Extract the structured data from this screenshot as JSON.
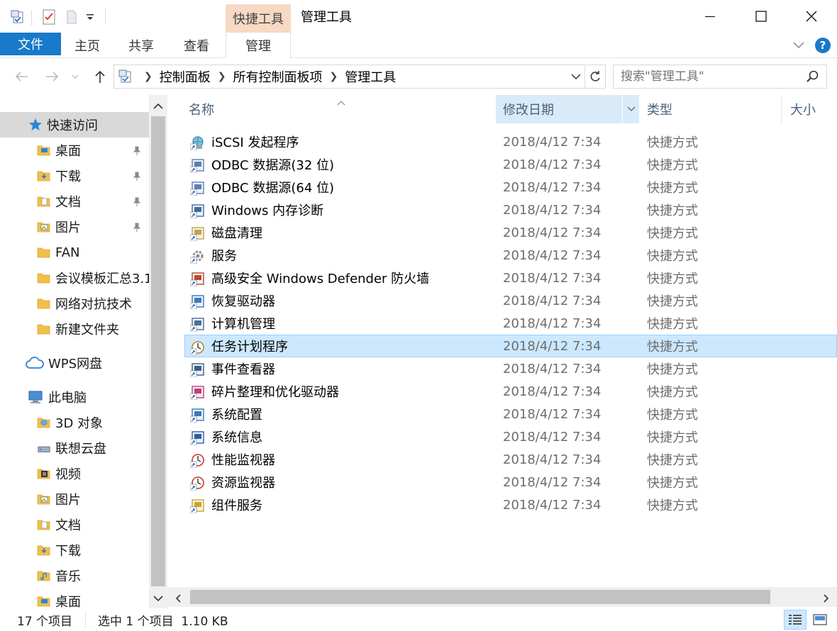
{
  "window": {
    "title": "管理工具",
    "context_tab": "快捷工具",
    "controls": {
      "minimize": "minimize-icon",
      "maximize": "maximize-icon",
      "close": "close-icon"
    }
  },
  "ribbon": {
    "file": "文件",
    "tabs": [
      "主页",
      "共享",
      "查看",
      "管理"
    ],
    "help_label": "?"
  },
  "address": {
    "crumbs": [
      "控制面板",
      "所有控制面板项",
      "管理工具"
    ],
    "search_placeholder": "搜索\"管理工具\""
  },
  "nav": {
    "quick_access": "快速访问",
    "items": [
      {
        "label": "桌面",
        "icon": "folder-blue-icon",
        "pinned": true
      },
      {
        "label": "下载",
        "icon": "download-folder-icon",
        "pinned": true
      },
      {
        "label": "文档",
        "icon": "documents-folder-icon",
        "pinned": true
      },
      {
        "label": "图片",
        "icon": "pictures-folder-icon",
        "pinned": true
      },
      {
        "label": "FAN",
        "icon": "folder-icon",
        "pinned": false
      },
      {
        "label": "会议模板汇总3.1",
        "icon": "folder-icon",
        "pinned": false
      },
      {
        "label": "网络对抗技术",
        "icon": "folder-icon",
        "pinned": false
      },
      {
        "label": "新建文件夹",
        "icon": "folder-icon",
        "pinned": false
      }
    ],
    "wps": "WPS网盘",
    "this_pc": "此电脑",
    "pc_items": [
      {
        "label": "3D 对象",
        "icon": "3d-objects-folder-icon"
      },
      {
        "label": "联想云盘",
        "icon": "cloud-drive-icon"
      },
      {
        "label": "视频",
        "icon": "videos-folder-icon"
      },
      {
        "label": "图片",
        "icon": "pictures-folder-icon"
      },
      {
        "label": "文档",
        "icon": "documents-folder-icon"
      },
      {
        "label": "下载",
        "icon": "download-folder-icon"
      },
      {
        "label": "音乐",
        "icon": "music-folder-icon"
      },
      {
        "label": "桌面",
        "icon": "folder-blue-icon"
      }
    ]
  },
  "columns": {
    "name": "名称",
    "date": "修改日期",
    "type": "类型",
    "size": "大小"
  },
  "files": [
    {
      "name": "iSCSI 发起程序",
      "date": "2018/4/12 7:34",
      "type": "快捷方式",
      "icon": "iscsi-globe-icon",
      "color": "#2f7fd1"
    },
    {
      "name": "ODBC 数据源(32 位)",
      "date": "2018/4/12 7:34",
      "type": "快捷方式",
      "icon": "odbc-icon",
      "color": "#5a7fb5"
    },
    {
      "name": "ODBC 数据源(64 位)",
      "date": "2018/4/12 7:34",
      "type": "快捷方式",
      "icon": "odbc-icon",
      "color": "#5a7fb5"
    },
    {
      "name": "Windows 内存诊断",
      "date": "2018/4/12 7:34",
      "type": "快捷方式",
      "icon": "memory-diagnostic-icon",
      "color": "#3c6e9c"
    },
    {
      "name": "磁盘清理",
      "date": "2018/4/12 7:34",
      "type": "快捷方式",
      "icon": "disk-cleanup-icon",
      "color": "#c9a24a"
    },
    {
      "name": "服务",
      "date": "2018/4/12 7:34",
      "type": "快捷方式",
      "icon": "services-gear-icon",
      "color": "#8a8a8a"
    },
    {
      "name": "高级安全 Windows Defender 防火墙",
      "date": "2018/4/12 7:34",
      "type": "快捷方式",
      "icon": "firewall-icon",
      "color": "#b94a2a"
    },
    {
      "name": "恢复驱动器",
      "date": "2018/4/12 7:34",
      "type": "快捷方式",
      "icon": "recovery-drive-icon",
      "color": "#3a78c2"
    },
    {
      "name": "计算机管理",
      "date": "2018/4/12 7:34",
      "type": "快捷方式",
      "icon": "computer-management-icon",
      "color": "#4a6f99"
    },
    {
      "name": "任务计划程序",
      "date": "2018/4/12 7:34",
      "type": "快捷方式",
      "icon": "task-scheduler-clock-icon",
      "color": "#b08a3a",
      "selected": true
    },
    {
      "name": "事件查看器",
      "date": "2018/4/12 7:34",
      "type": "快捷方式",
      "icon": "event-viewer-icon",
      "color": "#3b5f8a"
    },
    {
      "name": "碎片整理和优化驱动器",
      "date": "2018/4/12 7:34",
      "type": "快捷方式",
      "icon": "defrag-icon",
      "color": "#c43a7a"
    },
    {
      "name": "系统配置",
      "date": "2018/4/12 7:34",
      "type": "快捷方式",
      "icon": "system-config-icon",
      "color": "#3a7ab8"
    },
    {
      "name": "系统信息",
      "date": "2018/4/12 7:34",
      "type": "快捷方式",
      "icon": "system-info-icon",
      "color": "#2b5fa8"
    },
    {
      "name": "性能监视器",
      "date": "2018/4/12 7:34",
      "type": "快捷方式",
      "icon": "performance-monitor-icon",
      "color": "#c0392b"
    },
    {
      "name": "资源监视器",
      "date": "2018/4/12 7:34",
      "type": "快捷方式",
      "icon": "resource-monitor-icon",
      "color": "#c0392b"
    },
    {
      "name": "组件服务",
      "date": "2018/4/12 7:34",
      "type": "快捷方式",
      "icon": "component-services-icon",
      "color": "#d4a520"
    }
  ],
  "status": {
    "count": "17 个项目",
    "selection": "选中 1 个项目  1.10 KB"
  },
  "colors": {
    "accent": "#1979ca",
    "context_tab": "#f7d9c4",
    "selection": "#cce8ff",
    "sorted_header": "#d9ebf9",
    "folder": "#f0c04a"
  }
}
